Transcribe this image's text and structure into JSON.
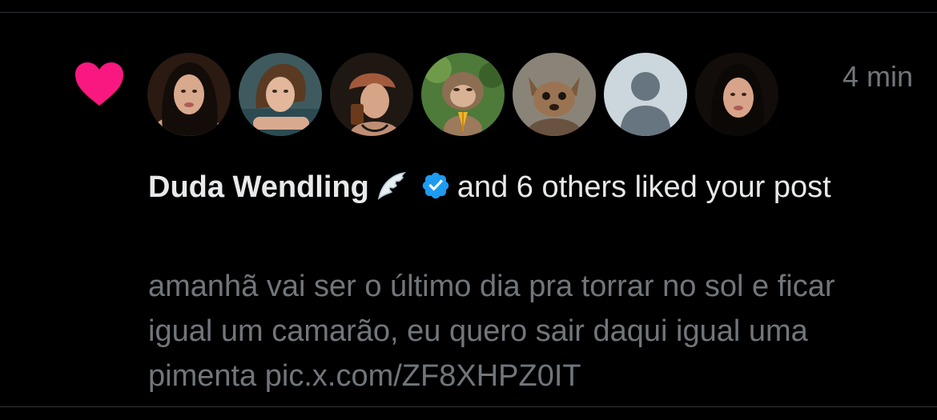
{
  "notification": {
    "type_icon": "heart-icon",
    "accent_color": "#f91880",
    "timestamp": "4 min",
    "avatars": [
      {
        "name": "avatar-duda-wendling",
        "kind": "photo-woman"
      },
      {
        "name": "avatar-liker-2",
        "kind": "photo-woman"
      },
      {
        "name": "avatar-liker-3",
        "kind": "photo-woman"
      },
      {
        "name": "avatar-liker-4",
        "kind": "photo-monkey"
      },
      {
        "name": "avatar-liker-5",
        "kind": "photo-dog"
      },
      {
        "name": "avatar-liker-6",
        "kind": "default-silhouette"
      },
      {
        "name": "avatar-liker-7",
        "kind": "photo-woman"
      }
    ],
    "actor_name": "Duda Wendling",
    "actor_emoji": "wing-emoji",
    "verified_icon": "verified-badge-icon",
    "verified_color": "#1d9bf0",
    "action_text": "and 6 others liked your post",
    "post_text": "amanhã vai ser o último dia pra torrar no sol e ficar igual um camarão, eu quero sair daqui igual uma pimenta pic.x.com/ZF8XHPZ0IT"
  }
}
